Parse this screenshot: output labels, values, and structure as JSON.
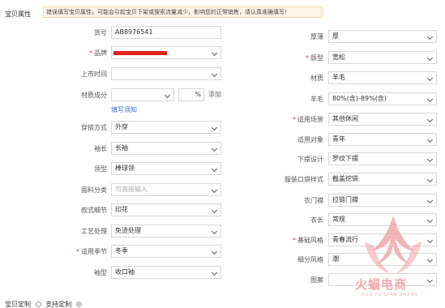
{
  "section": {
    "title": "宝贝属性",
    "notice": "错误填写宝贝属性，可能会引起宝贝下架或搜索流量减少，影响您的正常销售，请认真准确填写！"
  },
  "left": {
    "huohao": {
      "label": "货号",
      "value": "AB8976541"
    },
    "pinpai": {
      "label": "品牌"
    },
    "shangshi": {
      "label": "上市时间",
      "value": ""
    },
    "caizhi_chengfen": {
      "label": "材质成分",
      "value": "",
      "percent_unit": "%",
      "add": "添加",
      "guide_link": "填写须知"
    },
    "chuanda": {
      "label": "穿搭方式",
      "value": "外穿"
    },
    "xiuchang": {
      "label": "袖长",
      "value": "长袖"
    },
    "lingxing": {
      "label": "领型",
      "value": "棒球领"
    },
    "mianliao": {
      "label": "面料分类",
      "placeholder": "可直接输入"
    },
    "kuanshi": {
      "label": "款式细节",
      "value": "印花"
    },
    "gongyi": {
      "label": "工艺处理",
      "value": "免烫处理"
    },
    "jijie": {
      "label": "适用季节",
      "value": "冬季"
    },
    "xiuxing": {
      "label": "袖型",
      "value": "收口袖"
    }
  },
  "right": {
    "houbao": {
      "label": "厚薄",
      "value": "厚"
    },
    "banxing": {
      "label": "版型",
      "value": "宽松"
    },
    "caizhi": {
      "label": "材质",
      "value": "羊毛"
    },
    "yangmao": {
      "label": "羊毛",
      "value": "80%(含)-89%(含)"
    },
    "changjing": {
      "label": "适用场景",
      "value": "其他休闲"
    },
    "duixiang": {
      "label": "适用对象",
      "value": "青年"
    },
    "xiabai": {
      "label": "下摆设计",
      "value": "罗纹下摆"
    },
    "koudai": {
      "label": "服装口袋样式",
      "value": "截盖挖袋"
    },
    "yimenjin": {
      "label": "衣门襟",
      "value": "拉链门襟"
    },
    "yichang": {
      "label": "衣长",
      "value": "常规"
    },
    "jichu_fengge": {
      "label": "基础风格",
      "value": "青春流行"
    },
    "xifen_fengge": {
      "label": "细分风格",
      "value": "潮"
    },
    "tuan": {
      "label": "图案",
      "value": ""
    }
  },
  "bottom": {
    "label": "宝贝定制",
    "option": "支持定制"
  },
  "watermark": {
    "cn": "火蝠电商",
    "en": "HUO FU DIAN SHANG"
  },
  "colors": {
    "required": "#e4393c",
    "link": "#3c6ed3",
    "brand_redact": "#e2231a",
    "notice_bg": "#fff4e6",
    "watermark": "#f1a8ad"
  }
}
